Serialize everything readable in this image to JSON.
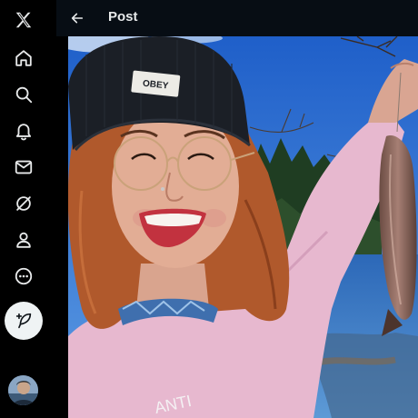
{
  "header": {
    "title": "Post",
    "back_icon": "arrow-left-icon"
  },
  "sidebar": {
    "items": [
      {
        "name": "x-logo",
        "icon": "x-logo-icon"
      },
      {
        "name": "home",
        "icon": "home-icon"
      },
      {
        "name": "explore",
        "icon": "search-icon"
      },
      {
        "name": "notifications",
        "icon": "bell-icon"
      },
      {
        "name": "messages",
        "icon": "mail-icon"
      },
      {
        "name": "grok",
        "icon": "grok-icon"
      },
      {
        "name": "profile",
        "icon": "person-icon"
      },
      {
        "name": "more",
        "icon": "more-circle-icon"
      }
    ],
    "post_button_icon": "feather-plus-icon"
  },
  "media": {
    "beanie_label": "OBEY",
    "shirt_text": "ANTI"
  },
  "colors": {
    "background": "#000000",
    "text": "#e7e9ea",
    "post_button": "#eff3f4",
    "header_bg": "#080e16"
  }
}
